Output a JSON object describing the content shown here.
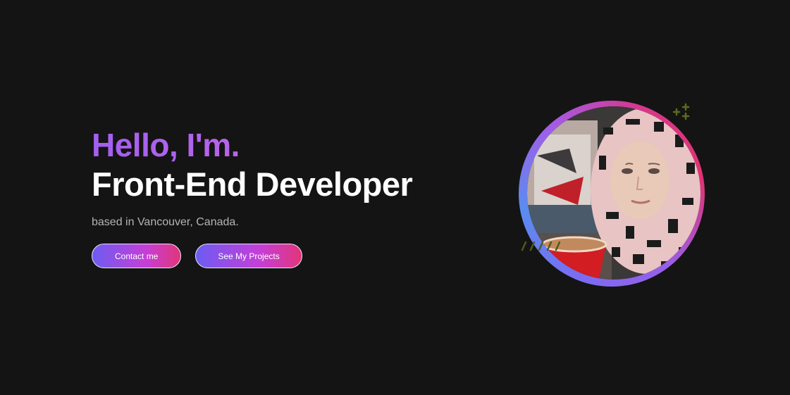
{
  "hero": {
    "greeting": "Hello, I'm.",
    "role": "Front-End Developer",
    "location": "based in Vancouver, Canada."
  },
  "actions": {
    "contact_label": "Contact me",
    "projects_label": "See My Projects"
  },
  "portrait": {
    "alt": "Portrait photo"
  },
  "decor": {
    "pluses": "+ +\n+",
    "slashes": "////"
  },
  "colors": {
    "background": "#141414",
    "greeting_gradient": [
      "#a35ff0",
      "#d06be0"
    ],
    "button_gradient": [
      "#6c5cf2",
      "#c43fd8",
      "#e2357a"
    ],
    "accent_olive": "#5d6b1e"
  }
}
